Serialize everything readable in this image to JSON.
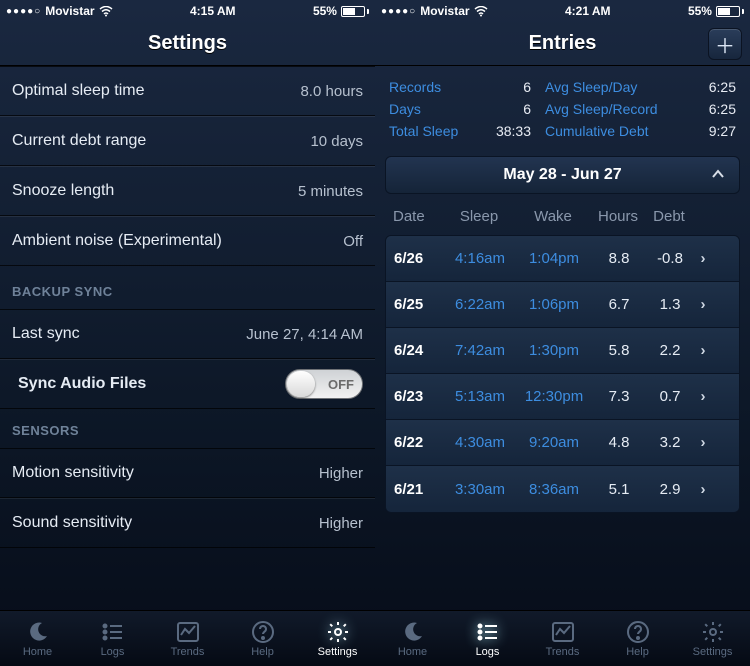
{
  "statusbar": {
    "carrier": "Movistar",
    "signal_dots": "●●●●○",
    "time_left": "4:15 AM",
    "time_right": "4:21 AM",
    "battery_pct": "55%"
  },
  "settings_screen": {
    "title": "Settings",
    "rows": {
      "optimal_sleep_label": "Optimal sleep time",
      "optimal_sleep_value": "8.0 hours",
      "debt_range_label": "Current debt range",
      "debt_range_value": "10 days",
      "snooze_label": "Snooze length",
      "snooze_value": "5 minutes",
      "ambient_label": "Ambient noise (Experimental)",
      "ambient_value": "Off"
    },
    "backup_header": "BACKUP SYNC",
    "last_sync_label": "Last sync",
    "last_sync_value": "June 27, 4:14 AM",
    "sync_audio_label": "Sync Audio Files",
    "sync_audio_state": "OFF",
    "sensors_header": "SENSORS",
    "motion_label": "Motion sensitivity",
    "motion_value": "Higher",
    "sound_label": "Sound sensitivity",
    "sound_value": "Higher"
  },
  "entries_screen": {
    "title": "Entries",
    "stats": {
      "records_label": "Records",
      "records_value": "6",
      "avg_day_label": "Avg Sleep/Day",
      "avg_day_value": "6:25",
      "days_label": "Days",
      "days_value": "6",
      "avg_rec_label": "Avg Sleep/Record",
      "avg_rec_value": "6:25",
      "total_label": "Total Sleep",
      "total_value": "38:33",
      "cum_label": "Cumulative Debt",
      "cum_value": "9:27"
    },
    "range": "May 28 - Jun 27",
    "columns": {
      "date": "Date",
      "sleep": "Sleep",
      "wake": "Wake",
      "hours": "Hours",
      "debt": "Debt"
    },
    "entries": [
      {
        "date": "6/26",
        "sleep": "4:16am",
        "wake": "1:04pm",
        "hours": "8.8",
        "debt": "-0.8"
      },
      {
        "date": "6/25",
        "sleep": "6:22am",
        "wake": "1:06pm",
        "hours": "6.7",
        "debt": "1.3"
      },
      {
        "date": "6/24",
        "sleep": "7:42am",
        "wake": "1:30pm",
        "hours": "5.8",
        "debt": "2.2"
      },
      {
        "date": "6/23",
        "sleep": "5:13am",
        "wake": "12:30pm",
        "hours": "7.3",
        "debt": "0.7"
      },
      {
        "date": "6/22",
        "sleep": "4:30am",
        "wake": "9:20am",
        "hours": "4.8",
        "debt": "3.2"
      },
      {
        "date": "6/21",
        "sleep": "3:30am",
        "wake": "8:36am",
        "hours": "5.1",
        "debt": "2.9"
      }
    ]
  },
  "tabbar": {
    "home": "Home",
    "logs": "Logs",
    "trends": "Trends",
    "help": "Help",
    "settings": "Settings"
  }
}
